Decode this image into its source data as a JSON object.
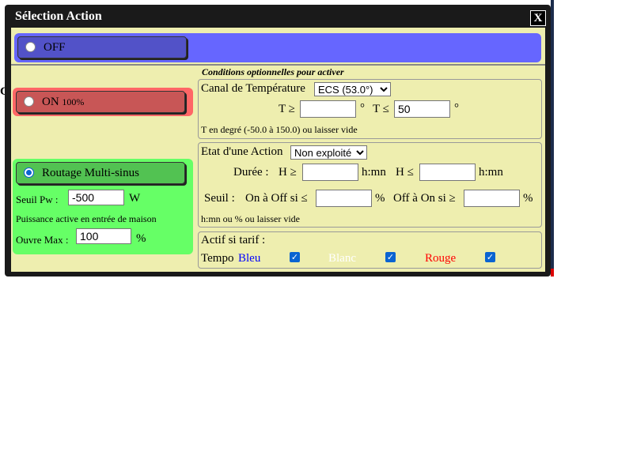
{
  "dialog": {
    "title": "Sélection Action",
    "close_label": "X"
  },
  "modes": {
    "off_label": "OFF",
    "on_label": "ON",
    "on_suffix": "100%",
    "multisinus_label": "Routage Multi-sinus",
    "selected": "multisinus"
  },
  "multisinus": {
    "seuil_label": "Seuil Pw :",
    "seuil_value": "-500",
    "seuil_unit": "W",
    "hint": "Puissance active en entrée de maison",
    "ouvre_label": "Ouvre Max :",
    "ouvre_value": "100",
    "ouvre_unit": "%"
  },
  "conditions": {
    "title": "Conditions optionnelles pour activer",
    "temperature": {
      "canal_label": "Canal de Température",
      "canal_selected": "ECS (53.0°)",
      "t_ge_label": "T ≥",
      "t_ge_value": "",
      "deg": "°",
      "t_le_label": "T ≤",
      "t_le_value": "50",
      "hint": "T en degré (-50.0 à 150.0) ou laisser vide"
    },
    "action": {
      "label": "Etat d'une Action",
      "selected": "Non exploité",
      "duree_label": "Durée :",
      "h_ge_label": "H ≥",
      "h_ge_value": "",
      "hmn1": "h:mn",
      "h_le_label": "H ≤",
      "h_le_value": "",
      "hmn2": "h:mn",
      "seuil_label": "Seuil :",
      "on_off_label": "On à Off si ≤",
      "on_off_value": "",
      "pct1": "%",
      "off_on_label": "Off à On si ≥",
      "off_on_value": "",
      "pct2": "%",
      "hint": "h:mn ou % ou laisser vide"
    },
    "tarif": {
      "label": "Actif si tarif :",
      "tempo_label": "Tempo",
      "bleu_label": "Bleu",
      "blanc_label": "Blanc",
      "rouge_label": "Rouge",
      "bleu_checked": true,
      "blanc_checked": true,
      "rouge_checked": true,
      "colors": {
        "bleu": "#0000ff",
        "blanc": "#ffffff",
        "rouge": "#ff0000"
      }
    }
  },
  "background": {
    "left_char": "C"
  }
}
